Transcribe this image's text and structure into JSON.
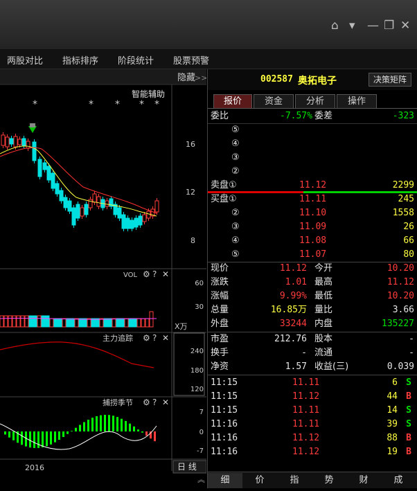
{
  "window": {
    "controls": [
      "home-icon",
      "menu-down-icon",
      "minimize-icon",
      "restore-icon",
      "close-icon"
    ]
  },
  "menu": {
    "items": [
      "两股对比",
      "指标排序",
      "阶段统计",
      "股票预警"
    ]
  },
  "left": {
    "hide_label": "隐藏",
    "hide_arrows": ">>",
    "smart_assist": "智能辅助",
    "stars": [
      "*",
      "*",
      "*",
      "*",
      "*"
    ],
    "price_axis": [
      "16",
      "12",
      "8"
    ],
    "vol_panel": {
      "title": "VOL",
      "axis": [
        "60",
        "30"
      ],
      "unit": "X万"
    },
    "zhuli_panel": {
      "title": "主力追踪",
      "axis": [
        "240",
        "180",
        "120"
      ]
    },
    "season_panel": {
      "title": "捕捞季节",
      "axis": [
        "7",
        "0",
        "-7"
      ]
    },
    "year_label": "2016",
    "period_label": "日 线",
    "collapse": "︽",
    "panel_icons": [
      "gear-icon",
      "help-icon",
      "close-icon"
    ]
  },
  "header": {
    "code": "002587",
    "name": "奥拓电子",
    "decision_button": "决策矩阵"
  },
  "tabs": [
    "报价",
    "资金",
    "分析",
    "操作"
  ],
  "quote": {
    "weibi_label": "委比",
    "weibi_value": "-7.57%",
    "weicha_label": "委差",
    "weicha_value": "-323",
    "sell_levels": [
      {
        "label": "⑤",
        "price": "",
        "vol": ""
      },
      {
        "label": "④",
        "price": "",
        "vol": ""
      },
      {
        "label": "③",
        "price": "",
        "vol": ""
      },
      {
        "label": "②",
        "price": "",
        "vol": ""
      }
    ],
    "sell1": {
      "label": "卖盘①",
      "price": "11.12",
      "vol": "2299"
    },
    "buy1": {
      "label": "买盘①",
      "price": "11.11",
      "vol": "245"
    },
    "buy_levels": [
      {
        "label": "②",
        "price": "11.10",
        "vol": "1558"
      },
      {
        "label": "③",
        "price": "11.09",
        "vol": "26"
      },
      {
        "label": "④",
        "price": "11.08",
        "vol": "66"
      },
      {
        "label": "⑤",
        "price": "11.07",
        "vol": "80"
      }
    ],
    "stats": [
      {
        "l1": "现价",
        "v1": "11.12",
        "l2": "今开",
        "v2": "10.20"
      },
      {
        "l1": "涨跌",
        "v1": "1.01",
        "l2": "最高",
        "v2": "11.12"
      },
      {
        "l1": "涨幅",
        "v1": "9.99%",
        "l2": "最低",
        "v2": "10.20"
      },
      {
        "l1": "总量",
        "v1": "16.85万",
        "l2": "量比",
        "v2": "3.66"
      },
      {
        "l1": "外盘",
        "v1": "33244",
        "l2": "内盘",
        "v2": "135227"
      }
    ],
    "stats2": [
      {
        "l1": "市盈",
        "v1": "212.76",
        "l2": "股本",
        "v2": "-"
      },
      {
        "l1": "换手",
        "v1": "-",
        "l2": "流通",
        "v2": "-"
      },
      {
        "l1": "净资",
        "v1": "1.57",
        "l2": "收益(三)",
        "v2": "0.039"
      }
    ]
  },
  "ticks": [
    {
      "time": "11:15",
      "price": "11.11",
      "vol": "6",
      "side": "S"
    },
    {
      "time": "11:15",
      "price": "11.12",
      "vol": "44",
      "side": "B"
    },
    {
      "time": "11:15",
      "price": "11.11",
      "vol": "14",
      "side": "S"
    },
    {
      "time": "11:16",
      "price": "11.11",
      "vol": "39",
      "side": "S"
    },
    {
      "time": "11:16",
      "price": "11.12",
      "vol": "88",
      "side": "B"
    },
    {
      "time": "11:16",
      "price": "11.12",
      "vol": "19",
      "side": "B"
    }
  ],
  "bottom_tabs": [
    "细",
    "价",
    "指",
    "势",
    "财",
    "成"
  ],
  "colors": {
    "up": "#ff3c3c",
    "down": "#00e0e0",
    "ma1": "#ffffff",
    "ma2": "#ffff40",
    "ma3": "#ff40ff"
  }
}
